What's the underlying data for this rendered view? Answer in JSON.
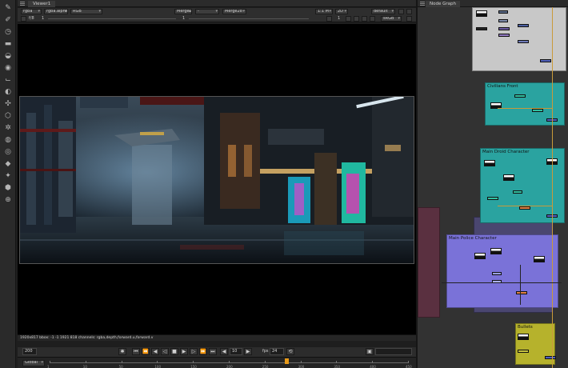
{
  "viewer": {
    "tab_title": "Viewer1",
    "channels": "rgba",
    "alpha_channel": "rgba.alpha",
    "color_mode": "RGB",
    "input_a": "Merge26",
    "operator": "-",
    "input_b": "Merge28",
    "zoom": "1:1 M",
    "view_2d": "2D",
    "view_profile": "default",
    "f_stop": "f/8",
    "gain": "1",
    "gamma": "1",
    "frame_count": "1",
    "colorspace": "sRGB",
    "info_line": "1920x817  bbox: -1 -1 1921 818 channels: rgba,depth,forward.u,forward.v"
  },
  "playback": {
    "current_frame": "200",
    "skip_frames": "10",
    "fps_label": "fps",
    "fps_value": "24",
    "timeline_range": "Global",
    "playhead_fraction": 0.66
  },
  "timeline": {
    "ticks": [
      "1",
      "10",
      "50",
      "100",
      "150",
      "200",
      "250",
      "300",
      "350",
      "400",
      "450"
    ]
  },
  "node_graph": {
    "tab_title": "Node Graph",
    "backdrops": [
      {
        "label": "Civilians Front",
        "color": "#2aa3a0"
      },
      {
        "label": "Main Droid Character",
        "color": "#2aa3a0"
      },
      {
        "label": "Main Police Character",
        "color": "#7a72d8"
      },
      {
        "label": "Bullets",
        "color": "#b6b22c"
      }
    ]
  },
  "toolbar": {
    "icons": [
      "pointer-icon",
      "paint-icon",
      "clock-icon",
      "channel-icon",
      "color-icon",
      "filter-icon",
      "keyer-icon",
      "merge-icon",
      "transform-icon",
      "3d-icon",
      "particles-icon",
      "deep-icon",
      "views-icon",
      "metadata-icon",
      "toolsets-icon",
      "other-icon",
      "furnace-icon"
    ]
  }
}
